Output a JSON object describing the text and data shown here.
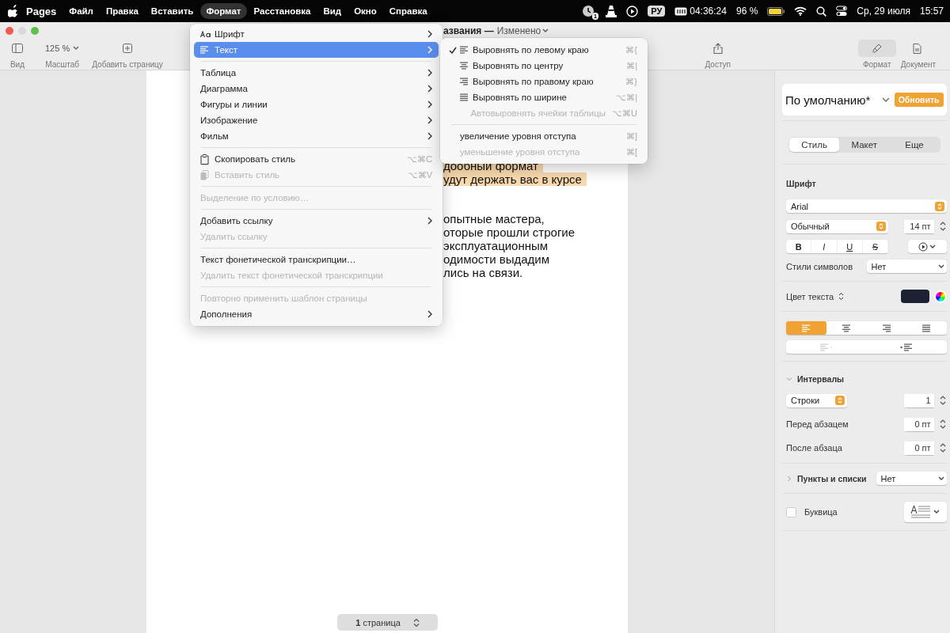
{
  "menubar": {
    "items": [
      {
        "label": "Pages",
        "kind": "app",
        "selected": false
      },
      {
        "label": "Файл",
        "kind": "menu",
        "selected": false
      },
      {
        "label": "Правка",
        "kind": "menu",
        "selected": false
      },
      {
        "label": "Вставить",
        "kind": "menu",
        "selected": false
      },
      {
        "label": "Формат",
        "kind": "menu",
        "selected": true
      },
      {
        "label": "Расстановка",
        "kind": "menu",
        "selected": false
      },
      {
        "label": "Вид",
        "kind": "menu",
        "selected": false
      },
      {
        "label": "Окно",
        "kind": "menu",
        "selected": false
      },
      {
        "label": "Справка",
        "kind": "menu",
        "selected": false
      }
    ],
    "status": {
      "badge": "1",
      "input_source": "РУ",
      "timer": "04:36:24",
      "battery": "96 %",
      "date": "Ср, 29 июля",
      "time": "15:57"
    }
  },
  "window": {
    "title": "азвания —",
    "status": "Изменено"
  },
  "toolbar": {
    "left": [
      {
        "label": "Вид",
        "kind": "sidebar"
      },
      {
        "label": "Масштаб",
        "kind": "zoom",
        "value": "125 %"
      },
      {
        "label": "Добавить страницу",
        "kind": "add"
      }
    ],
    "share": {
      "label": "Доступ"
    },
    "inspector_tabs": [
      {
        "label": "Формат",
        "kind": "format",
        "selected": true
      },
      {
        "label": "Документ",
        "kind": "document",
        "selected": false
      }
    ]
  },
  "document": {
    "blocks": [
      {
        "highlighted": true,
        "lines": [
          "дообный формат",
          "удут держать вас в курсе"
        ]
      },
      {
        "highlighted": false,
        "lines": [
          "опытные мастера,",
          "оторые прошли строгие",
          "эксплуатационным",
          "одимости выдадим",
          "лись на связи."
        ]
      }
    ],
    "page_indicator": "**1** страница"
  },
  "format_menu": {
    "items": [
      {
        "kind": "font",
        "label": "Шрифт",
        "submenu": true,
        "disabled": false,
        "selected": false
      },
      {
        "kind": "text",
        "label": "Текст",
        "submenu": true,
        "disabled": false,
        "selected": true
      },
      {
        "kind": "separator"
      },
      {
        "kind": "plain",
        "label": "Таблица",
        "submenu": true,
        "disabled": false,
        "selected": false
      },
      {
        "kind": "plain",
        "label": "Диаграмма",
        "submenu": true,
        "disabled": false,
        "selected": false
      },
      {
        "kind": "plain",
        "label": "Фигуры и линии",
        "submenu": true,
        "disabled": false,
        "selected": false
      },
      {
        "kind": "plain",
        "label": "Изображение",
        "submenu": true,
        "disabled": false,
        "selected": false
      },
      {
        "kind": "plain",
        "label": "Фильм",
        "submenu": true,
        "disabled": false,
        "selected": false
      },
      {
        "kind": "separator"
      },
      {
        "kind": "copy",
        "label": "Скопировать стиль",
        "shortcut": "⌥⌘C",
        "submenu": false,
        "disabled": false,
        "selected": false
      },
      {
        "kind": "paste",
        "label": "Вставить стиль",
        "shortcut": "⌥⌘V",
        "submenu": false,
        "disabled": true,
        "selected": false
      },
      {
        "kind": "separator"
      },
      {
        "kind": "plain",
        "label": "Выделение по условию…",
        "submenu": false,
        "disabled": true,
        "selected": false
      },
      {
        "kind": "separator"
      },
      {
        "kind": "plain",
        "label": "Добавить ссылку",
        "submenu": true,
        "disabled": false,
        "selected": false
      },
      {
        "kind": "plain",
        "label": "Удалить ссылку",
        "submenu": false,
        "disabled": true,
        "selected": false
      },
      {
        "kind": "separator"
      },
      {
        "kind": "plain",
        "label": "Текст фонетической транскрипции…",
        "submenu": false,
        "disabled": false,
        "selected": false
      },
      {
        "kind": "plain",
        "label": "Удалить текст фонетической транскрипции",
        "submenu": false,
        "disabled": true,
        "selected": false
      },
      {
        "kind": "separator"
      },
      {
        "kind": "plain",
        "label": "Повторно применить шаблон страницы",
        "submenu": false,
        "disabled": true,
        "selected": false
      },
      {
        "kind": "plain",
        "label": "Дополнения",
        "submenu": true,
        "disabled": false,
        "selected": false
      }
    ]
  },
  "text_submenu": {
    "items": [
      {
        "kind": "left",
        "label": "Выровнять по левому краю",
        "shortcut": "⌘{",
        "checked": true,
        "disabled": false
      },
      {
        "kind": "center",
        "label": "Выровнять по центру",
        "shortcut": "⌘|",
        "checked": false,
        "disabled": false
      },
      {
        "kind": "right",
        "label": "Выровнять по правому краю",
        "shortcut": "⌘}",
        "checked": false,
        "disabled": false
      },
      {
        "kind": "justify",
        "label": "Выровнять по ширине",
        "shortcut": "⌥⌘|",
        "checked": false,
        "disabled": false
      },
      {
        "kind": "blank",
        "label": "Автовыровнять ячейки таблицы",
        "shortcut": "⌥⌘U",
        "checked": false,
        "disabled": true
      },
      {
        "kind": "separator"
      },
      {
        "kind": "plain",
        "label": "увеличение уровня отступа",
        "shortcut": "⌘]",
        "checked": false,
        "disabled": false
      },
      {
        "kind": "plain",
        "label": "уменьшение уровня отступа",
        "shortcut": "⌘[",
        "checked": false,
        "disabled": true
      }
    ]
  },
  "sidebar": {
    "style": {
      "name": "По умолчанию*",
      "button": "Обновить"
    },
    "tabs": [
      {
        "label": "Стиль",
        "selected": true
      },
      {
        "label": "Макет",
        "selected": false
      },
      {
        "label": "Еще",
        "selected": false
      }
    ],
    "font": {
      "heading": "Шрифт",
      "family": "Arial",
      "typeface": "Обычный",
      "size": "14 пт",
      "styles": [
        {
          "label": "B",
          "kind": "bold"
        },
        {
          "label": "I",
          "kind": "italic"
        },
        {
          "label": "U",
          "kind": "underline"
        },
        {
          "label": "S",
          "kind": "strike"
        }
      ],
      "char_styles_label": "Стили символов",
      "char_style": "Нет",
      "color_label": "Цвет текста",
      "color": "#1c2233"
    },
    "alignment": [
      {
        "kind": "left",
        "selected": true
      },
      {
        "kind": "center",
        "selected": false
      },
      {
        "kind": "right",
        "selected": false
      },
      {
        "kind": "justify",
        "selected": false
      }
    ],
    "indent": [
      {
        "kind": "decrease",
        "disabled": true
      },
      {
        "kind": "increase",
        "disabled": false
      }
    ],
    "spacing": {
      "heading": "Интервалы",
      "expanded": true,
      "mode": "Строки",
      "value": "1",
      "before_label": "Перед абзацем",
      "before": "0 пт",
      "after_label": "После абзаца",
      "after": "0 пт"
    },
    "lists": {
      "heading": "Пункты и списки",
      "expanded": false,
      "value": "Нет"
    },
    "drop_cap": {
      "label": "Буквица",
      "checked": false
    }
  }
}
